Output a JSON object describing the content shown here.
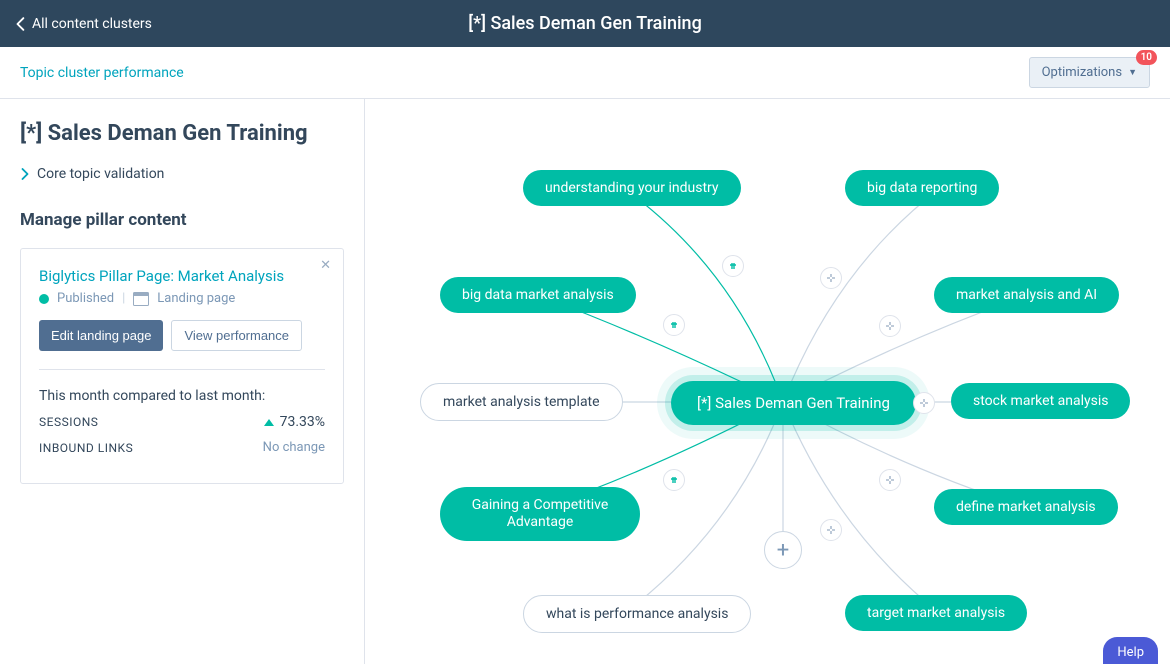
{
  "topbar": {
    "back_label": "All content clusters",
    "title": "[*] Sales Deman Gen Training"
  },
  "subbar": {
    "link_label": "Topic cluster performance",
    "optim_label": "Optimizations",
    "badge_count": "10"
  },
  "sidebar": {
    "page_title": "[*] Sales Deman Gen Training",
    "validation_label": "Core topic validation",
    "manage_heading": "Manage pillar content",
    "card": {
      "link_title": "Biglytics Pillar Page: Market Analysis",
      "status_label": "Published",
      "type_label": "Landing page",
      "edit_btn": "Edit landing page",
      "view_btn": "View performance",
      "compare_label": "This month compared to last month:",
      "stats": {
        "sessions_label": "SESSIONS",
        "sessions_value": "73.33%",
        "inbound_label": "INBOUND LINKS",
        "inbound_value": "No change"
      }
    }
  },
  "canvas": {
    "center_label": "[*] Sales Deman Gen Training",
    "nodes": {
      "understanding": "understanding your industry",
      "big_data_reporting": "big data reporting",
      "big_data_market": "big data market analysis",
      "market_ai": "market analysis and AI",
      "template": "market analysis template",
      "stock": "stock market analysis",
      "gaining": "Gaining a Competitive Advantage",
      "define": "define market analysis",
      "perf": "what is performance analysis",
      "target": "target market analysis"
    }
  },
  "colors": {
    "teal": "#00bda5",
    "link": "#00a4bd",
    "navy": "#2e475d",
    "red": "#f2545b"
  }
}
